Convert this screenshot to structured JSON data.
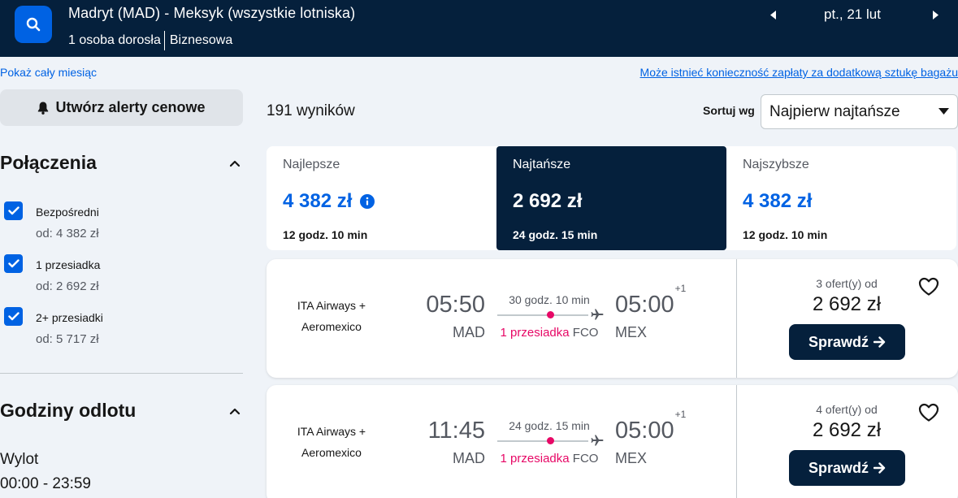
{
  "header": {
    "route": "Madryt (MAD) - Meksyk (wszystkie lotniska)",
    "passengers": "1 osoba dorosła",
    "cabin": "Biznesowa",
    "date": "pt., 21 lut"
  },
  "links": {
    "month": "Pokaż cały miesiąc",
    "baggage": "Może istnieć konieczność zapłaty za dodatkową sztukę bagażu"
  },
  "sidebar": {
    "alert_button": "Utwórz alerty cenowe",
    "connections_title": "Połączenia",
    "stops": [
      {
        "label": "Bezpośredni",
        "price": "od: 4 382 zł"
      },
      {
        "label": "1 przesiadka",
        "price": "od: 2 692 zł"
      },
      {
        "label": "2+ przesiadki",
        "price": "od: 5 717 zł"
      }
    ],
    "departure_title": "Godziny odlotu",
    "outbound_label": "Wylot",
    "outbound_range": "00:00 - 23:59"
  },
  "results": {
    "count": "191 wyników",
    "sort_label": "Sortuj wg",
    "sort_value": "Najpierw najtańsze"
  },
  "tabs": [
    {
      "name": "Najlepsze",
      "price": "4 382 zł",
      "duration": "12 godz. 10 min"
    },
    {
      "name": "Najtańsze",
      "price": "2 692 zł",
      "duration": "24 godz. 15 min"
    },
    {
      "name": "Najszybsze",
      "price": "4 382 zł",
      "duration": "12 godz. 10 min"
    }
  ],
  "flights": [
    {
      "airline_1": "ITA Airways +",
      "airline_2": "Aeromexico",
      "dep_time": "05:50",
      "dep_airport": "MAD",
      "arr_time": "05:00",
      "arr_offset": "+1",
      "arr_airport": "MEX",
      "duration": "30 godz. 10 min",
      "stops": "1 przesiadka",
      "via": "FCO",
      "offers": "3 ofert(y) od",
      "price": "2 692 zł",
      "button": "Sprawdź"
    },
    {
      "airline_1": "ITA Airways +",
      "airline_2": "Aeromexico",
      "dep_time": "11:45",
      "dep_airport": "MAD",
      "arr_time": "05:00",
      "arr_offset": "+1",
      "arr_airport": "MEX",
      "duration": "24 godz. 15 min",
      "stops": "1 przesiadka",
      "via": "FCO",
      "offers": "4 ofert(y) od",
      "price": "2 692 zł",
      "button": "Sprawdź"
    }
  ],
  "colors": {
    "brand_dark": "#05203c",
    "brand_blue": "#0062e3",
    "stop_red": "#e70866"
  }
}
